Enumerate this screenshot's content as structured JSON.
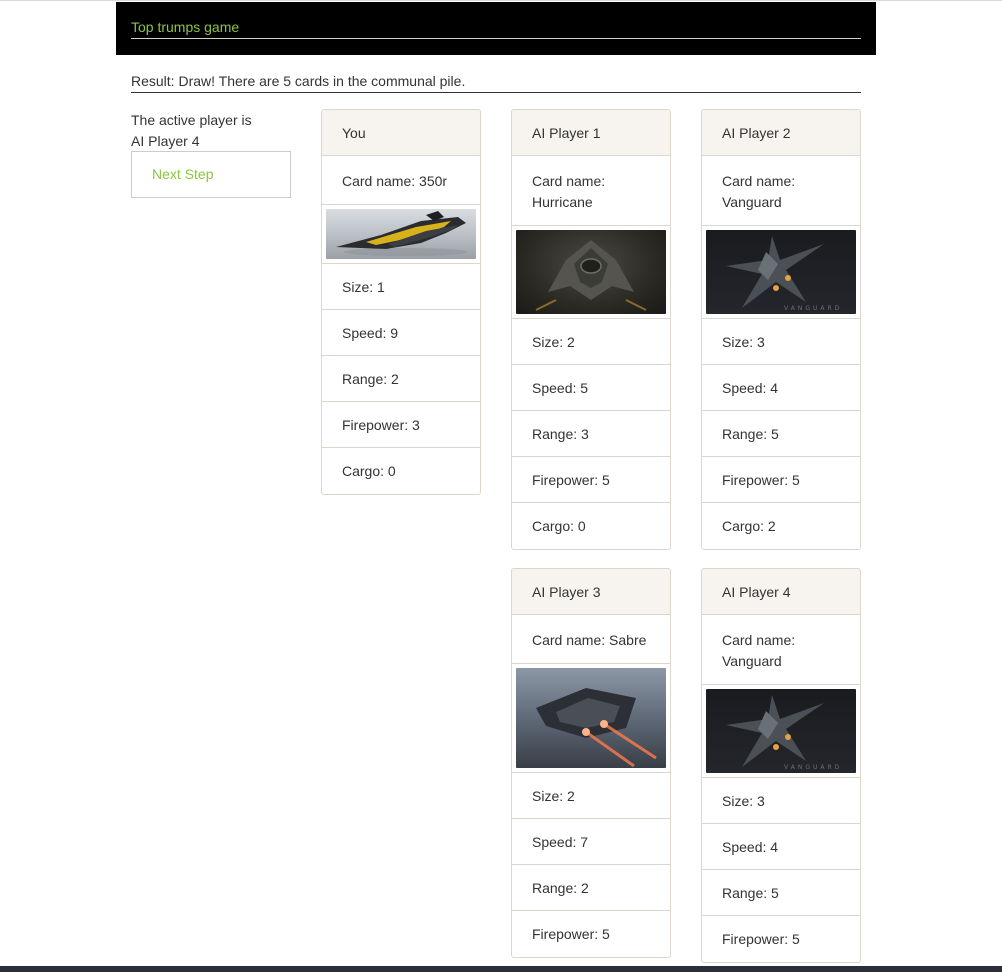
{
  "header": {
    "title": "Top trumps game"
  },
  "result": {
    "text": "Result: Draw! There are 5 cards in the communal pile."
  },
  "active": {
    "line1": "The active player is",
    "line2": "AI Player 4"
  },
  "controls": {
    "next_step": "Next Step"
  },
  "cards": [
    {
      "player": "You",
      "name": "Card name: 350r",
      "image": "350r-ship-image",
      "stats": [
        "Size: 1",
        "Speed: 9",
        "Range: 2",
        "Firepower: 3",
        "Cargo: 0"
      ]
    },
    {
      "player": "AI Player 1",
      "name": "Card name: Hurricane",
      "image": "hurricane-ship-image",
      "stats": [
        "Size: 2",
        "Speed: 5",
        "Range: 3",
        "Firepower: 5",
        "Cargo: 0"
      ]
    },
    {
      "player": "AI Player 2",
      "name": "Card name: Vanguard",
      "image": "vanguard-ship-image",
      "stats": [
        "Size: 3",
        "Speed: 4",
        "Range: 5",
        "Firepower: 5",
        "Cargo: 2"
      ]
    },
    {
      "player": "AI Player 3",
      "name": "Card name: Sabre",
      "image": "sabre-ship-image",
      "stats": [
        "Size: 2",
        "Speed: 7",
        "Range: 2",
        "Firepower: 5"
      ]
    },
    {
      "player": "AI Player 4",
      "name": "Card name: Vanguard",
      "image": "vanguard-ship-image",
      "stats": [
        "Size: 3",
        "Speed: 4",
        "Range: 5",
        "Firepower: 5"
      ]
    }
  ],
  "image_captions": {
    "vanguard": "VANGUARD"
  },
  "colors": {
    "accent": "#8cc63f",
    "header_bg": "#000000",
    "card_head_bg": "#f7f4f0",
    "card_border": "#dcd6cd"
  }
}
